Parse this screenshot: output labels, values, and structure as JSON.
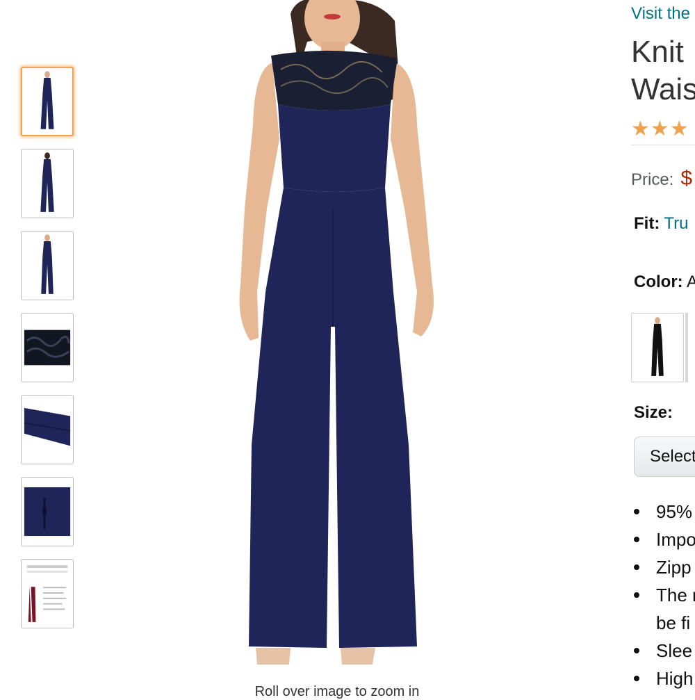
{
  "store_link": "Visit the",
  "title_lines": [
    "Knit",
    "Wais"
  ],
  "rating_stars": "★★★",
  "price": {
    "label": "Price:",
    "value": "$"
  },
  "fit": {
    "label": "Fit:",
    "value": "Tru"
  },
  "color": {
    "label": "Color:",
    "value": "A"
  },
  "size": {
    "label": "Size:",
    "select_text": "Select"
  },
  "bullets": [
    {
      "line1": "95%",
      "line2": ""
    },
    {
      "line1": "Impo",
      "line2": ""
    },
    {
      "line1": "Zipp",
      "line2": ""
    },
    {
      "line1": "The r",
      "line2": "be fi"
    },
    {
      "line1": "Slee",
      "line2": ""
    },
    {
      "line1": "High",
      "line2": ""
    }
  ],
  "zoom_hint": "Roll over image to zoom in",
  "thumbnails": [
    {
      "name": "full-front",
      "selected": true
    },
    {
      "name": "full-back",
      "selected": false
    },
    {
      "name": "full-front-alt",
      "selected": false
    },
    {
      "name": "lace-detail",
      "selected": false
    },
    {
      "name": "fabric-detail",
      "selected": false
    },
    {
      "name": "zipper-detail",
      "selected": false
    },
    {
      "name": "size-chart",
      "selected": false
    }
  ],
  "colors": {
    "accent": "#f0a14b",
    "link": "#007185",
    "price": "#b12704",
    "garment": "#1f2559"
  }
}
